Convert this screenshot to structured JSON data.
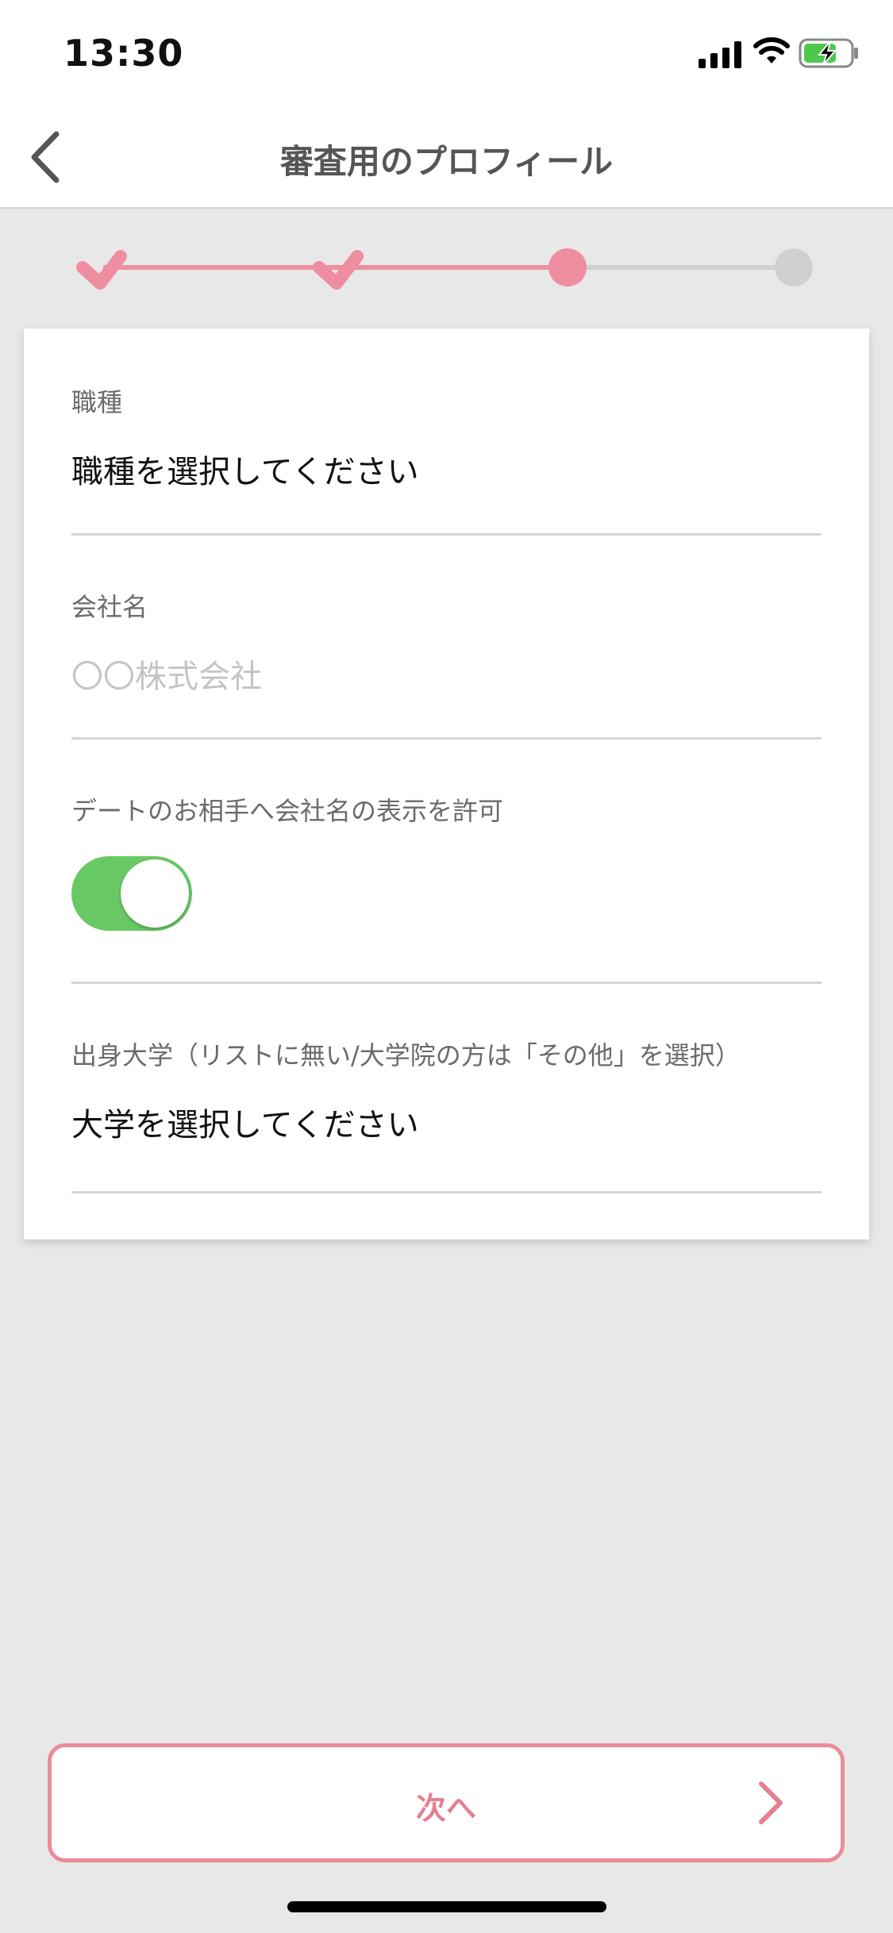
{
  "status_bar": {
    "time": "13:30",
    "icons": [
      "signal-icon",
      "wifi-icon",
      "battery-charging-icon"
    ]
  },
  "nav": {
    "title": "審査用のプロフィール",
    "back_icon": "chevron-left-icon"
  },
  "progress": {
    "total_steps": 4,
    "completed_steps": 2,
    "current_step": 3,
    "accent": "#ef8ea0",
    "inactive": "#d0d0d0"
  },
  "form": {
    "job": {
      "label": "職種",
      "value": "職種を選択してください"
    },
    "company": {
      "label": "会社名",
      "placeholder": "〇〇株式会社"
    },
    "show_company": {
      "label": "デートのお相手へ会社名の表示を許可",
      "enabled": true,
      "on_color": "#68c964"
    },
    "university": {
      "label": "出身大学（リストに無い/大学院の方は「その他」を選択）",
      "value": "大学を選択してください"
    }
  },
  "footer": {
    "next_label": "次へ",
    "next_icon": "chevron-right-icon",
    "accent": "#ea8b9b"
  }
}
